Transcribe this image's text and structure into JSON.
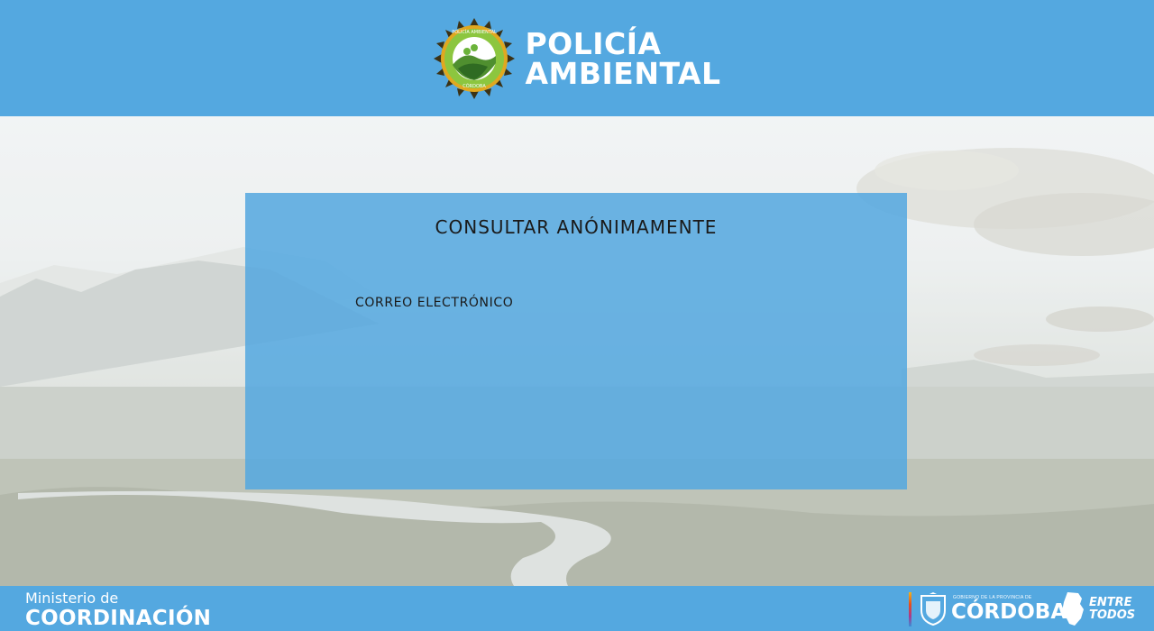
{
  "header": {
    "logo_icon": "policia-ambiental-badge",
    "logo_ring_top": "POLICÍA AMBIENTAL",
    "logo_ring_bottom": "CÓRDOBA",
    "title_line1": "POLICÍA",
    "title_line2": "AMBIENTAL"
  },
  "form": {
    "title": "CONSULTAR ANÓNIMAMENTE",
    "email_label": "CORREO ELECTRÓNICO",
    "email_value": ""
  },
  "footer": {
    "ministry_line1": "Ministerio de",
    "ministry_line2": "COORDINACIÓN",
    "gov_small": "Gobierno de la Provincia de",
    "gov_name": "CÓRDOBA",
    "slogan_line1": "ENTRE",
    "slogan_line2": "TODOS"
  },
  "colors": {
    "brand_blue": "#54a8e0",
    "card_blue": "#54a8e0",
    "text_dark": "#1a1a1a",
    "white": "#ffffff"
  }
}
